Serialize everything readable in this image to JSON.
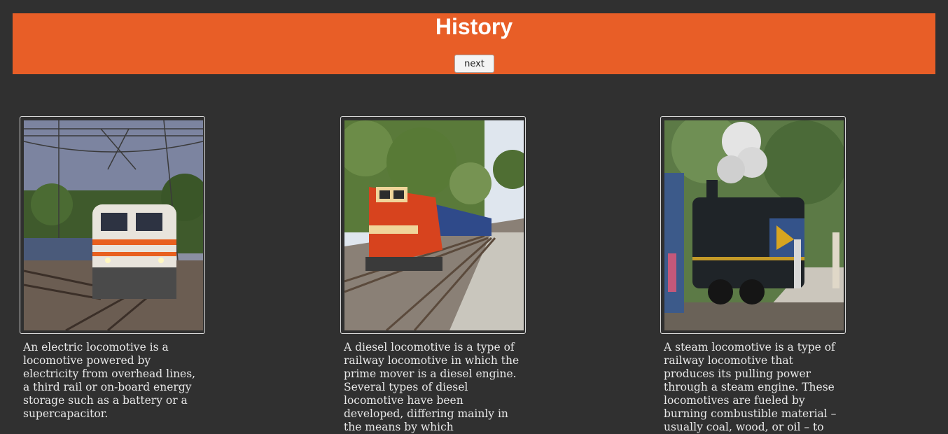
{
  "header": {
    "title": "History",
    "next_label": "next",
    "background": "#e85e27"
  },
  "cards": [
    {
      "image_icon": "electric-locomotive-photo",
      "caption": "An electric locomotive is a locomotive powered by electricity from overhead lines, a third rail or on-board energy storage such as a battery or a supercapacitor."
    },
    {
      "image_icon": "diesel-locomotive-photo",
      "caption": "A diesel locomotive is a type of railway locomotive in which the prime mover is a diesel engine. Several types of diesel locomotive have been developed, differing mainly in the means by which"
    },
    {
      "image_icon": "steam-locomotive-photo",
      "caption": "A steam locomotive is a type of railway locomotive that produces its pulling power through a steam engine. These locomotives are fueled by burning combustible material – usually coal, wood, or oil – to"
    }
  ],
  "colors": {
    "page_background": "#303030",
    "text": "#e8e8e8"
  }
}
